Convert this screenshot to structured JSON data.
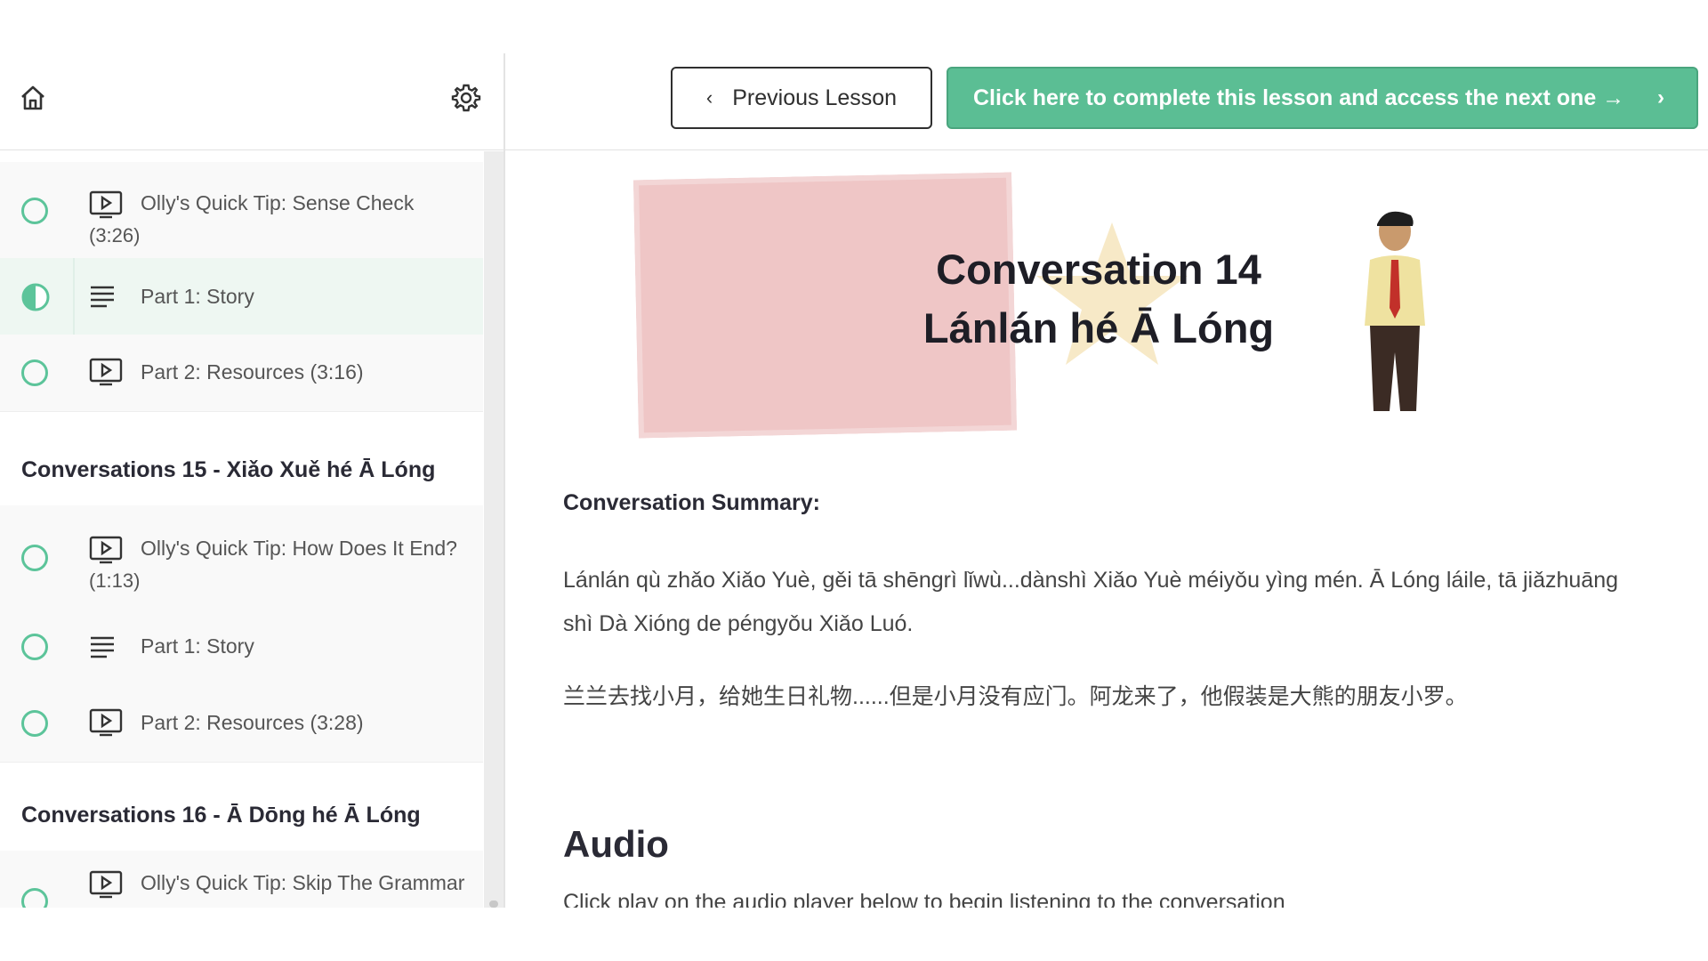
{
  "nav": {
    "prev_label": "Previous Lesson",
    "next_label": "Click here to complete this lesson and access the next one →"
  },
  "sidebar": {
    "group14_items": [
      {
        "label": "Olly's Quick Tip: Sense Check",
        "duration": "(3:26)",
        "type": "video",
        "status": "incomplete"
      },
      {
        "label": "Part 1: Story",
        "type": "text",
        "status": "in-progress"
      },
      {
        "label": "Part 2: Resources (3:16)",
        "type": "video",
        "status": "incomplete"
      }
    ],
    "section15_title": "Conversations 15 - Xiǎo Xuě hé Ā Lóng",
    "group15_items": [
      {
        "label": "Olly's Quick Tip: How Does It End?",
        "duration": "(1:13)",
        "type": "video",
        "status": "incomplete"
      },
      {
        "label": "Part 1: Story",
        "type": "text",
        "status": "incomplete"
      },
      {
        "label": "Part 2: Resources (3:28)",
        "type": "video",
        "status": "incomplete"
      }
    ],
    "section16_title": "Conversations 16 - Ā Dōng hé Ā Lóng",
    "group16_items": [
      {
        "label": "Olly's Quick Tip: Skip The Grammar",
        "type": "video",
        "status": "incomplete"
      }
    ]
  },
  "banner": {
    "line1": "Conversation 14",
    "line2": "Lánlán hé Ā Lóng"
  },
  "content": {
    "summary_heading": "Conversation Summary:",
    "summary_pinyin": "Lánlán qù zhǎo Xiǎo Yuè, gěi tā shēngrì lǐwù...dànshì Xiǎo Yuè méiyǒu yìng mén. Ā Lóng láile, tā jiǎzhuāng shì Dà Xióng de péngyǒu Xiǎo Luó.",
    "summary_hanzi": "兰兰去找小月，给她生日礼物......但是小月没有应门。阿龙来了，他假装是大熊的朋友小罗。",
    "audio_heading": "Audio",
    "audio_desc": "Click play on the audio player below to begin listening to the conversation"
  },
  "colors": {
    "accent": "#5bbe94",
    "banner_bg": "#efc6c6",
    "active_row": "#eef7f2"
  }
}
